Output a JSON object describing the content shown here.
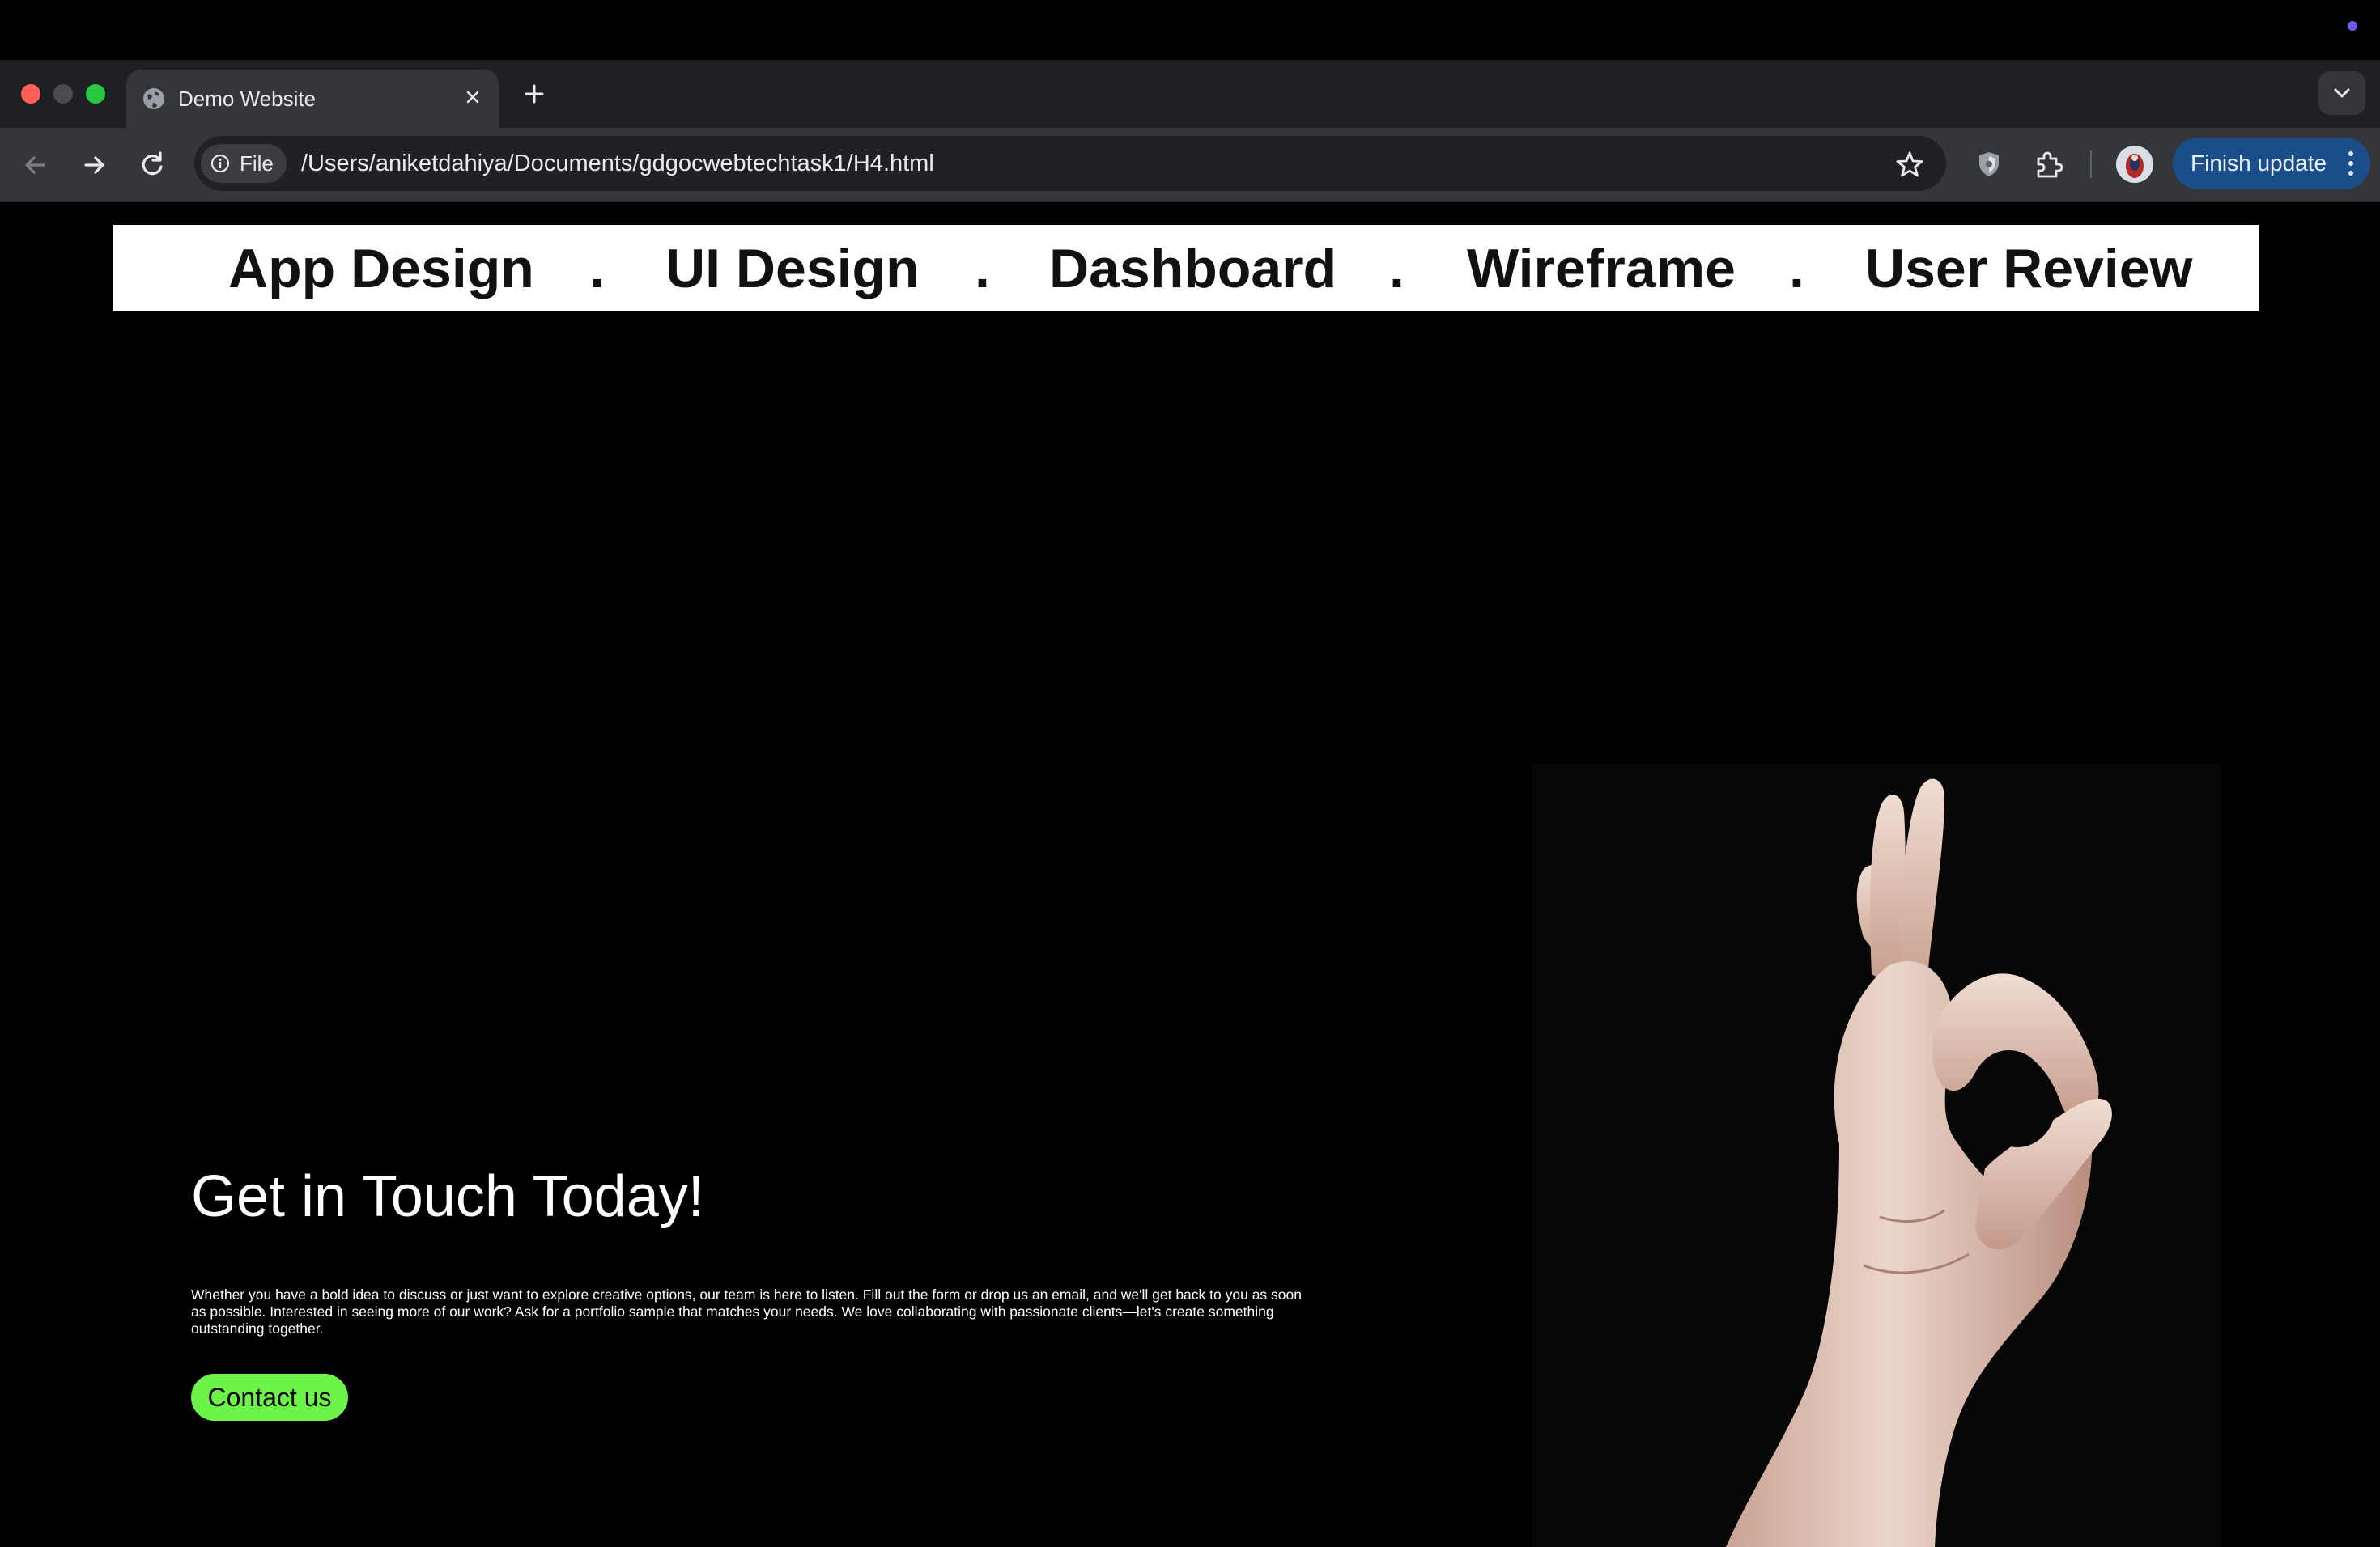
{
  "browser": {
    "tab_title": "Demo Website",
    "address_chip": "File",
    "url": "/Users/aniketdahiya/Documents/gdgocwebtechtask1/H4.html",
    "update_button": "Finish update"
  },
  "page": {
    "nav_items": [
      {
        "label": "App Design"
      },
      {
        "label": "UI Design"
      },
      {
        "label": "Dashboard"
      },
      {
        "label": "Wireframe"
      },
      {
        "label": "User Review"
      }
    ],
    "nav_separator": ".",
    "hero": {
      "title": "Get in Touch Today!",
      "body": "Whether you have a bold idea to discuss or just want to explore creative options, our team is here to listen. Fill out the form or drop us an email, and we'll get back to you as soon as possible. Interested in seeing more of our work? Ask for a portfolio sample that matches your needs. We love collaborating with passionate clients—let's create something outstanding together.",
      "cta_label": "Contact us"
    },
    "image": {
      "subject": "ok-hand-gesture-photo"
    }
  },
  "colors": {
    "page_background": "#000000",
    "nav_background": "#ffffff",
    "cta_background": "#6cf548",
    "browser_toolbar": "#35363a",
    "update_button": "#1a4e8a"
  },
  "icons": [
    "globe-icon",
    "close-icon",
    "plus-icon",
    "chevron-down-icon",
    "back-arrow-icon",
    "forward-arrow-icon",
    "reload-icon",
    "info-icon",
    "star-icon",
    "shield-icon",
    "puzzle-icon",
    "kebab-menu-icon"
  ]
}
